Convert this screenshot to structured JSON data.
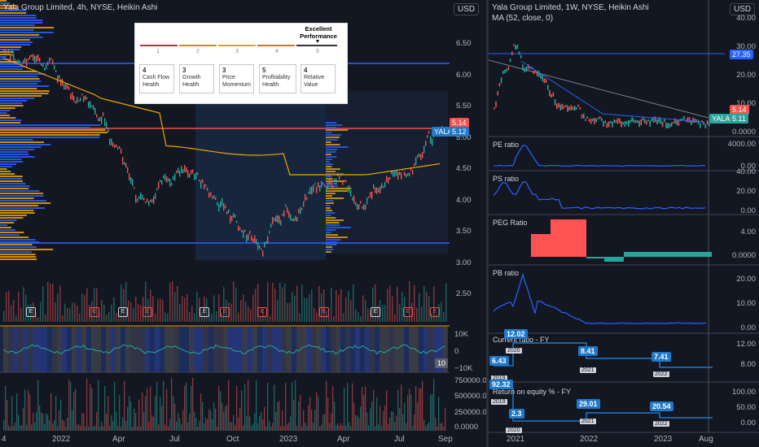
{
  "left_chart": {
    "title": "Yala Group Limited, 4h, NYSE, Heikin Ashi",
    "currency": "USD",
    "price_axis": [
      "6.50",
      "6.00",
      "5.50",
      "5.00",
      "4.50",
      "4.00",
      "3.50",
      "3.00",
      "2.50"
    ],
    "last_price_red": "5.14",
    "last_price_blue": "5.12",
    "ticker": "YALA",
    "volume_axis": [
      "10K",
      "0",
      "−10K"
    ],
    "volume_badge": "10",
    "vol_axis": [
      "750000.00",
      "500000.00",
      "250000.00",
      "0.0000"
    ],
    "time_axis": [
      "4",
      "2022",
      "Apr",
      "Jul",
      "Oct",
      "2023",
      "Apr",
      "Jul",
      "Sep"
    ],
    "earnings_marks": [
      "E",
      "E",
      "E",
      "E",
      "E",
      "E",
      "E",
      "E",
      "E",
      "E",
      "E"
    ]
  },
  "scorecard": {
    "top_label": "Excellent Performance",
    "scale": [
      "1",
      "2",
      "3",
      "4",
      "5"
    ],
    "cards": [
      {
        "score": "4",
        "label": "Cash Flow Health"
      },
      {
        "score": "3",
        "label": "Growth Health"
      },
      {
        "score": "3",
        "label": "Price Momentum"
      },
      {
        "score": "5",
        "label": "Profitability Health"
      },
      {
        "score": "4",
        "label": "Relative Value"
      }
    ]
  },
  "right_chart": {
    "title": "Yala Group Limited, 1W, NYSE, Heikin Ashi",
    "ma_label": "MA (52, close, 0)",
    "currency": "USD",
    "price_axis": [
      "40.00",
      "30.00",
      "20.00",
      "10.00",
      "0.0000"
    ],
    "tag_blue": "27.35",
    "tag_red": "5.14",
    "tag_teal": "5.11",
    "ticker": "YALA",
    "time_axis": [
      "2021",
      "2022",
      "2023",
      "Aug"
    ],
    "panels": {
      "pe": {
        "title": "PE ratio",
        "axis": [
          "4000.00",
          "0.00"
        ]
      },
      "ps": {
        "title": "PS ratio",
        "axis": [
          "40.00",
          "20.00",
          "0.00"
        ]
      },
      "peg": {
        "title": "PEG Ratio",
        "axis": [
          "4.00",
          "0.0000"
        ]
      },
      "pb": {
        "title": "PB ratio",
        "axis": [
          "20.00",
          "10.00",
          "0.00"
        ]
      },
      "cr": {
        "title": "Current ratio - FY",
        "axis": [
          "12.00",
          "8.00"
        ],
        "values": [
          "12.02",
          "6.43",
          "8.41",
          "7.41"
        ],
        "years": [
          "2020",
          "2019",
          "2021",
          "2022"
        ]
      },
      "roe": {
        "title": "Return on equity % - FY",
        "axis": [
          "100.00",
          "50.00",
          "0.00"
        ],
        "values": [
          "92.32",
          "2.3",
          "29.01",
          "20.54"
        ],
        "years": [
          "2019",
          "2020",
          "2021",
          "2022"
        ]
      }
    }
  },
  "colors": {
    "bg": "#131722",
    "up": "#26a69a",
    "down": "#ef5350",
    "blue": "#2962ff",
    "orange": "#f0a500",
    "grid": "#2a2e39"
  }
}
